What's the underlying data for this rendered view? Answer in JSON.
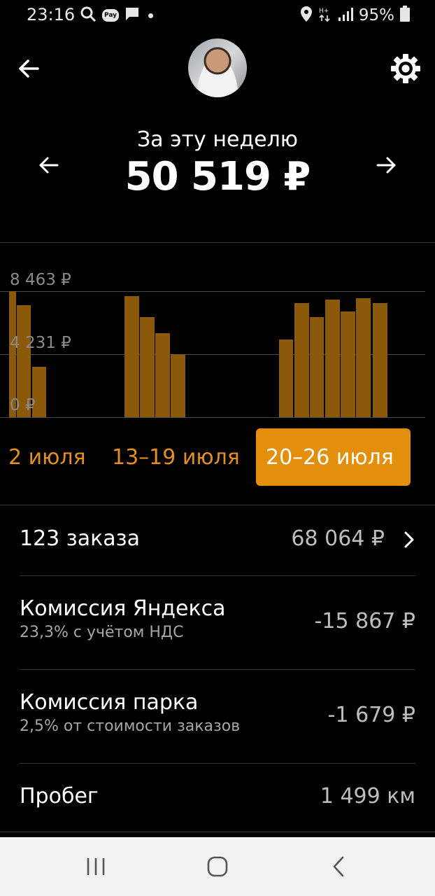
{
  "status_bar": {
    "time": "23:16",
    "battery": "95%",
    "icons_left": [
      "search-icon",
      "pay-icon",
      "message-icon",
      "dot-icon"
    ],
    "icons_right": [
      "location-icon",
      "data-icon",
      "signal-icon",
      "battery-icon"
    ],
    "pay_label": "Pay"
  },
  "header": {
    "back_icon": "arrow-left-icon",
    "settings_icon": "gear-icon",
    "avatar": "user-avatar"
  },
  "period": {
    "title": "За эту неделю",
    "sum": "50 519 ₽",
    "prev_icon": "arrow-left-icon",
    "next_icon": "arrow-right-icon"
  },
  "chart_data": {
    "type": "bar",
    "y_tick_labels": [
      "8 463 ₽",
      "4 231 ₽",
      "0 ₽"
    ],
    "ylim": [
      0,
      8463
    ],
    "grid": true,
    "values": [
      8463,
      7500,
      3400,
      8150,
      6700,
      5650,
      4250,
      5200,
      7650,
      6700,
      7900,
      7100,
      8000,
      7650
    ],
    "bar_color": "#8a5a0a"
  },
  "weeks": [
    {
      "label": "2 июля",
      "active": false
    },
    {
      "label": "13–19 июля",
      "active": false
    },
    {
      "label": "20–26 июля",
      "active": true
    }
  ],
  "accent_color": "#e38f0c",
  "rows": [
    {
      "title": "123 заказа",
      "value": "68 064 ₽",
      "chevron": "chevron-right-icon"
    },
    {
      "title": "Комиссия Яндекса",
      "subtitle": "23,3% с учётом НДС",
      "value": "-15 867 ₽"
    },
    {
      "title": "Комиссия парка",
      "subtitle": "2,5% от стоимости заказов",
      "value": "-1 679 ₽"
    },
    {
      "title": "Пробег",
      "value": "1 499 км"
    }
  ],
  "nav": [
    "recents-icon",
    "home-icon",
    "back-icon"
  ]
}
